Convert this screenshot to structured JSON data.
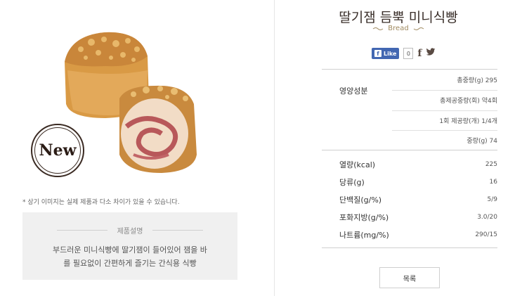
{
  "product": {
    "title": "딸기잼 듬뿍 미니식빵",
    "category": "Bread",
    "badge": "New",
    "notice": "* 상기 이미지는 실제 제품과 다소 차이가 있을 수 있습니다.",
    "description_title": "제품설명",
    "description": "부드러운 미니식빵에 딸기잼이 들어있어 잼을 바를 필요없이 간편하게 즐기는 간식용 식빵"
  },
  "social": {
    "like_label": "Like",
    "like_count": "0",
    "icons": [
      "facebook-icon",
      "twitter-icon"
    ]
  },
  "nutrition": {
    "group_label": "영양성분",
    "sub_items": [
      "총중량(g) 295",
      "총제공중량(회) 약4회",
      "1회 제공량(개) 1/4개",
      "중량(g) 74"
    ],
    "rows": [
      {
        "label": "열량(kcal)",
        "value": "225"
      },
      {
        "label": "당류(g)",
        "value": "16"
      },
      {
        "label": "단백질(g/%)",
        "value": "5/9"
      },
      {
        "label": "포화지방(g/%)",
        "value": "3.0/20"
      },
      {
        "label": "나트륨(mg/%)",
        "value": "290/15"
      }
    ]
  },
  "buttons": {
    "list_label": "목록"
  },
  "colors": {
    "accent": "#a08a60",
    "facebook": "#4267b2",
    "box_bg": "#f0f0f0"
  }
}
